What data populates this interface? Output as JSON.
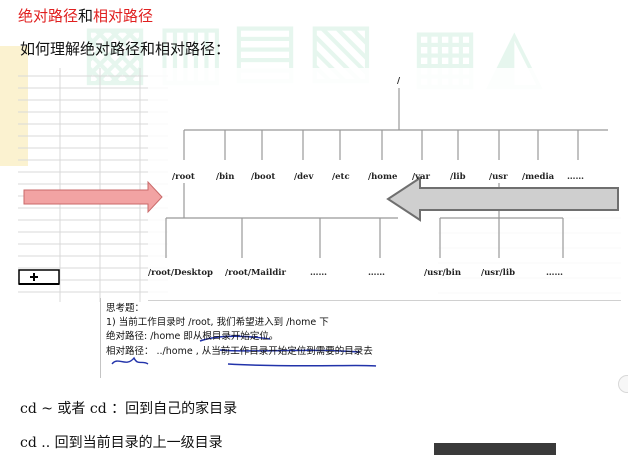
{
  "heading": {
    "part1": "绝对路径",
    "conj": "和",
    "part2": "相对路径"
  },
  "question": "如何理解绝对路径和相对路径：",
  "tree": {
    "root": "/",
    "level1": [
      "/root",
      "/bin",
      "/boot",
      "/dev",
      "/etc",
      "/home",
      "/var",
      "/lib",
      "/usr",
      "/media",
      "……"
    ],
    "level2_left": [
      "/root/Desktop",
      "/root/Maildir",
      "……",
      "……"
    ],
    "level2_right": [
      "/usr/bin",
      "/usr/lib",
      "……"
    ]
  },
  "note": {
    "title": "思考题：",
    "line1": "1) 当前工作目录时 /root, 我们希望进入到 /home 下",
    "line2": "绝对路径: /home 即从根目录开始定位。",
    "line3": "相对路径：  ../home , 从当前工作目录开始定位到需要的目录去"
  },
  "commands": [
    "cd ~  或者 cd  ：回到自己的家目录",
    "cd ..  回到当前目录的上一级目录"
  ],
  "colors": {
    "heading_red": "#e02020",
    "arrow_pink": "#f2a3a3",
    "arrow_gray": "#c8c8c8",
    "ink_blue": "#2233aa"
  }
}
